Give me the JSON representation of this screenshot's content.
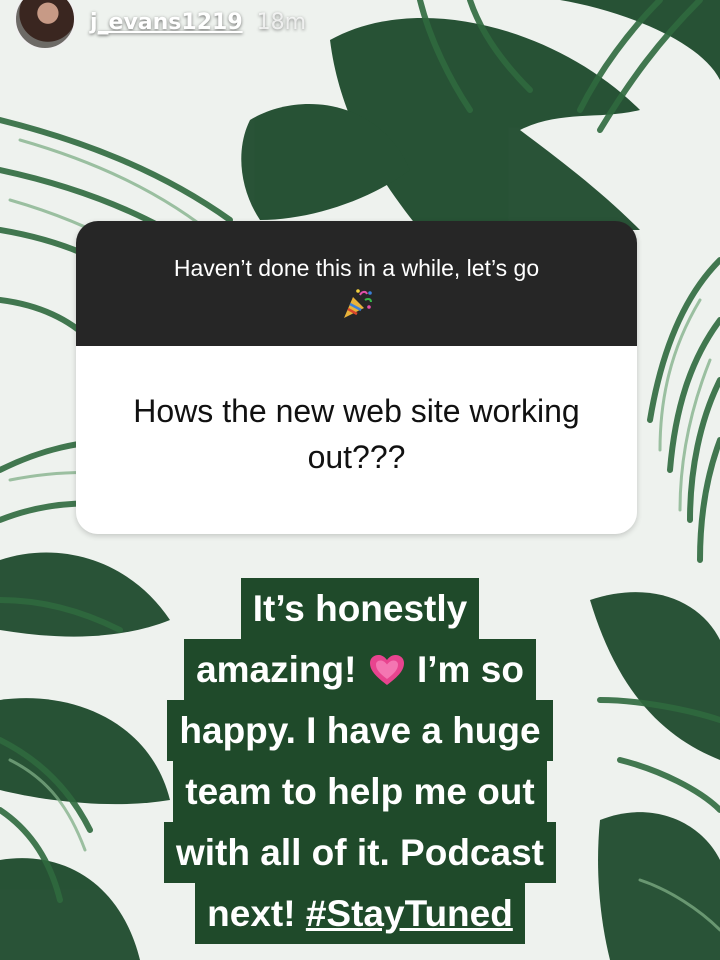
{
  "story": {
    "username": "j_evans1219",
    "timestamp": "18m"
  },
  "question_sticker": {
    "prompt": "Haven’t done this in a while, let’s go",
    "prompt_emoji": "party-popper-icon",
    "question": "Hows the new web site working out???"
  },
  "answer": {
    "lines": [
      "It’s honestly",
      "amazing!",
      "I’m so",
      "happy. I have a huge",
      "team to help me out",
      "with all of it. Podcast",
      "next!",
      "#StayTuned"
    ],
    "emoji": "growing-heart-icon"
  },
  "colors": {
    "sticker_header_bg": "#262626",
    "sticker_body_bg": "#ffffff",
    "answer_highlight_bg": "#1f4a2a",
    "text_white": "#ffffff"
  }
}
